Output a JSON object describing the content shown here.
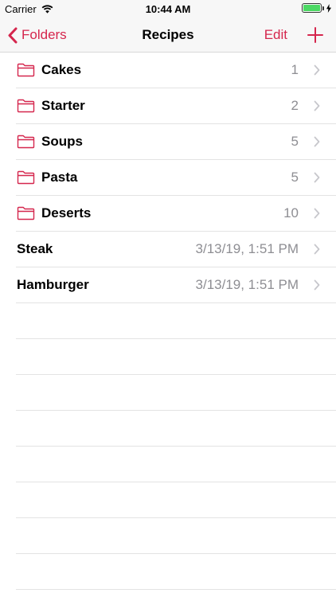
{
  "status_bar": {
    "carrier": "Carrier",
    "time": "10:44 AM",
    "battery_level": 1.0
  },
  "nav": {
    "back_label": "Folders",
    "title": "Recipes",
    "edit_label": "Edit",
    "add_icon": "plus-icon"
  },
  "folders": [
    {
      "name": "Cakes",
      "count": "1"
    },
    {
      "name": "Starter",
      "count": "2"
    },
    {
      "name": "Soups",
      "count": "5"
    },
    {
      "name": "Pasta",
      "count": "5"
    },
    {
      "name": "Deserts",
      "count": "10"
    }
  ],
  "recipes": [
    {
      "name": "Steak",
      "date": "3/13/19, 1:51 PM"
    },
    {
      "name": "Hamburger",
      "date": "3/13/19, 1:51 PM"
    }
  ],
  "colors": {
    "accent": "#d5264d",
    "detail_text": "#8e8e93",
    "chevron": "#c7c7cc",
    "battery": "#4cd964"
  }
}
